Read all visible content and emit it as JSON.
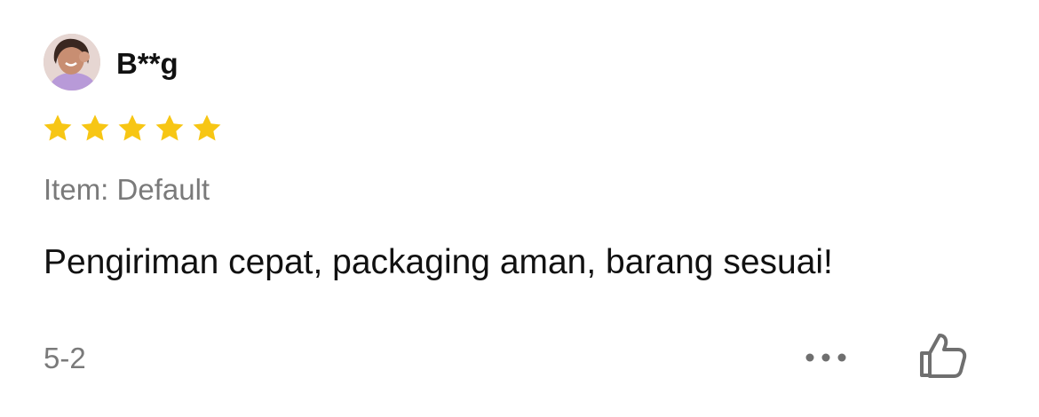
{
  "review": {
    "username": "B**g",
    "rating": 5,
    "max_rating": 5,
    "variant_text": "Item: Default",
    "comment": "Pengiriman cepat, packaging aman, barang sesuai!",
    "date": "5-2"
  },
  "icons": {
    "star": "star-icon",
    "more": "more-dots-icon",
    "like": "thumbs-up-icon",
    "avatar": "user-avatar"
  },
  "colors": {
    "star": "#F7C614",
    "primary_text": "#111111",
    "secondary_text": "#7A7A7A",
    "icon_gray": "#6F6F6F"
  }
}
